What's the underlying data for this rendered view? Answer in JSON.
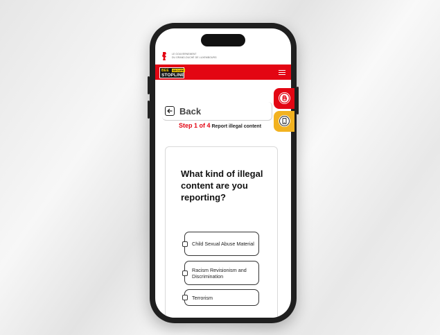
{
  "gov_header": {
    "line1": "LE GOUVERNEMENT",
    "line2": "DU GRAND-DUCHÉ DE LUXEMBOURG"
  },
  "logo": {
    "top_left": "BEE",
    "top_right": "SECURE",
    "bottom": "STOPLINE"
  },
  "icons": {
    "menu": "hamburger-icon",
    "report_tab": "stop-hand-icon",
    "secondary_tab": "phone-icon",
    "back": "arrow-left-icon"
  },
  "colors": {
    "brand_red": "#e30613",
    "brand_yellow": "#f2b220"
  },
  "back_label": "Back",
  "step": {
    "counter": "Step 1 of 4",
    "title": "Report illegal content"
  },
  "question": "What kind of illegal content are you reporting?",
  "options": [
    {
      "label": "Child Sexual Abuse Material"
    },
    {
      "label": "Racism Revisionism and Discrimination"
    },
    {
      "label": "Terrorism"
    }
  ]
}
